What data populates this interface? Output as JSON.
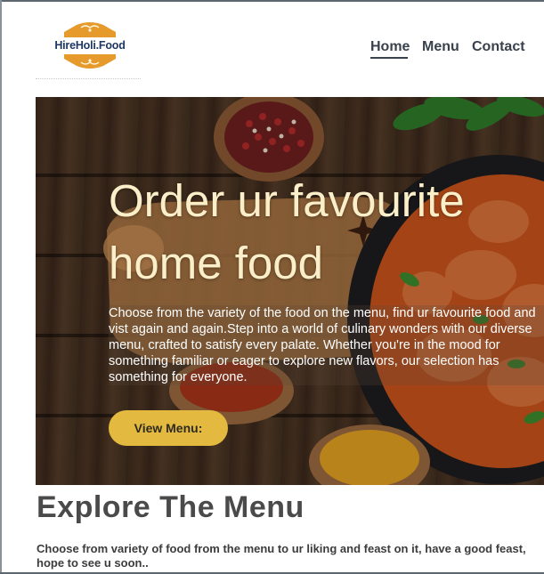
{
  "brand": {
    "logo_text": "HireHoli.Food",
    "colors": {
      "badge": "#e59a2b",
      "badge_text": "#1f3763"
    }
  },
  "nav": {
    "items": [
      {
        "label": "Home",
        "active": true
      },
      {
        "label": "Menu",
        "active": false
      },
      {
        "label": "Contact",
        "active": false
      }
    ]
  },
  "hero": {
    "title": "Order ur favourite home food",
    "description": "Choose from the variety of the food on the menu, find ur favourite food and vist again and again.Step into a world of culinary wonders with our diverse menu, crafted to satisfy every palate. Whether you're in the mood for something familiar or eager to explore new flavors, our selection has something for everyone.",
    "button_label": "View Menu:",
    "colors": {
      "title": "#fbefca",
      "button": "#e3b93f",
      "wood": "#4a3424"
    }
  },
  "explore": {
    "title": "Explore The Menu",
    "text": "Choose from variety of food from the menu to ur liking and feast on it, have a good feast, hope to see u soon.."
  }
}
